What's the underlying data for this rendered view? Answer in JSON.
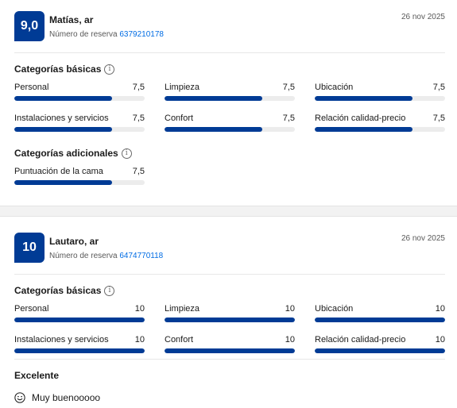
{
  "reviews": [
    {
      "score": "9,0",
      "name": "Matías, ar",
      "reservation_label": "Número de reserva",
      "reservation_number": "6379210178",
      "date": "26 nov 2025",
      "basic_title": "Categorías básicas",
      "basic": [
        {
          "label": "Personal",
          "value": "7,5",
          "fraction": 0.75
        },
        {
          "label": "Limpieza",
          "value": "7,5",
          "fraction": 0.75
        },
        {
          "label": "Ubicación",
          "value": "7,5",
          "fraction": 0.75
        },
        {
          "label": "Instalaciones y servicios",
          "value": "7,5",
          "fraction": 0.75
        },
        {
          "label": "Confort",
          "value": "7,5",
          "fraction": 0.75
        },
        {
          "label": "Relación calidad-precio",
          "value": "7,5",
          "fraction": 0.75
        }
      ],
      "additional_title": "Categorías adicionales",
      "additional": [
        {
          "label": "Puntuación de la cama",
          "value": "7,5",
          "fraction": 0.75
        }
      ]
    },
    {
      "score": "10",
      "name": "Lautaro, ar",
      "reservation_label": "Número de reserva",
      "reservation_number": "6474770118",
      "date": "26 nov 2025",
      "basic_title": "Categorías básicas",
      "basic": [
        {
          "label": "Personal",
          "value": "10",
          "fraction": 1.0
        },
        {
          "label": "Limpieza",
          "value": "10",
          "fraction": 1.0
        },
        {
          "label": "Ubicación",
          "value": "10",
          "fraction": 1.0
        },
        {
          "label": "Instalaciones y servicios",
          "value": "10",
          "fraction": 1.0
        },
        {
          "label": "Confort",
          "value": "10",
          "fraction": 1.0
        },
        {
          "label": "Relación calidad-precio",
          "value": "10",
          "fraction": 1.0
        }
      ],
      "review_title": "Excelente",
      "comment": "Muy buenooooo",
      "comment_icon": "smiley-icon"
    }
  ],
  "colors": {
    "accent": "#003b95",
    "link": "#006ce4",
    "track": "#ececec"
  }
}
